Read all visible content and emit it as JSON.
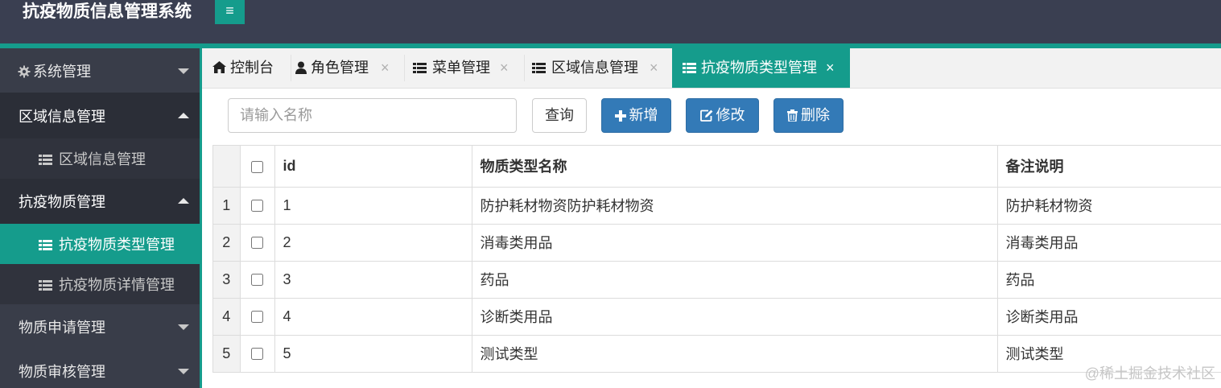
{
  "app": {
    "title": "抗疫物质信息管理系统"
  },
  "icons": {
    "menu_toggle": "≡",
    "home": "home-icon",
    "user": "user-icon",
    "list": "list-icon",
    "gear": "gear-icon",
    "close": "×"
  },
  "colors": {
    "accent": "#159c8c",
    "header": "#3a3f51",
    "sidebar": "#393d49",
    "primary_button": "#337ab7"
  },
  "sidebar": {
    "system": "系统管理",
    "region_group": "区域信息管理",
    "region_item": "区域信息管理",
    "material_group": "抗疫物质管理",
    "material_type_item": "抗疫物质类型管理",
    "material_detail_item": "抗疫物质详情管理",
    "apply_group": "物质申请管理",
    "audit_group": "物质审核管理"
  },
  "tabs": {
    "dashboard": "控制台",
    "roles": "角色管理",
    "menus": "菜单管理",
    "regions": "区域信息管理",
    "material_types": "抗疫物质类型管理"
  },
  "toolbar": {
    "search_placeholder": "请输入名称",
    "search_value": "",
    "query": "查询",
    "add": "新增",
    "edit": "修改",
    "delete": "删除"
  },
  "table": {
    "headers": {
      "id": "id",
      "name": "物质类型名称",
      "remark": "备注说明"
    },
    "rows": [
      {
        "num": "1",
        "id": "1",
        "name": "防护耗材物资防护耗材物资",
        "remark": "防护耗材物资"
      },
      {
        "num": "2",
        "id": "2",
        "name": "消毒类用品",
        "remark": "消毒类用品"
      },
      {
        "num": "3",
        "id": "3",
        "name": "药品",
        "remark": "药品"
      },
      {
        "num": "4",
        "id": "4",
        "name": "诊断类用品",
        "remark": "诊断类用品"
      },
      {
        "num": "5",
        "id": "5",
        "name": "测试类型",
        "remark": "测试类型"
      }
    ]
  },
  "watermark": "@稀土掘金技术社区"
}
